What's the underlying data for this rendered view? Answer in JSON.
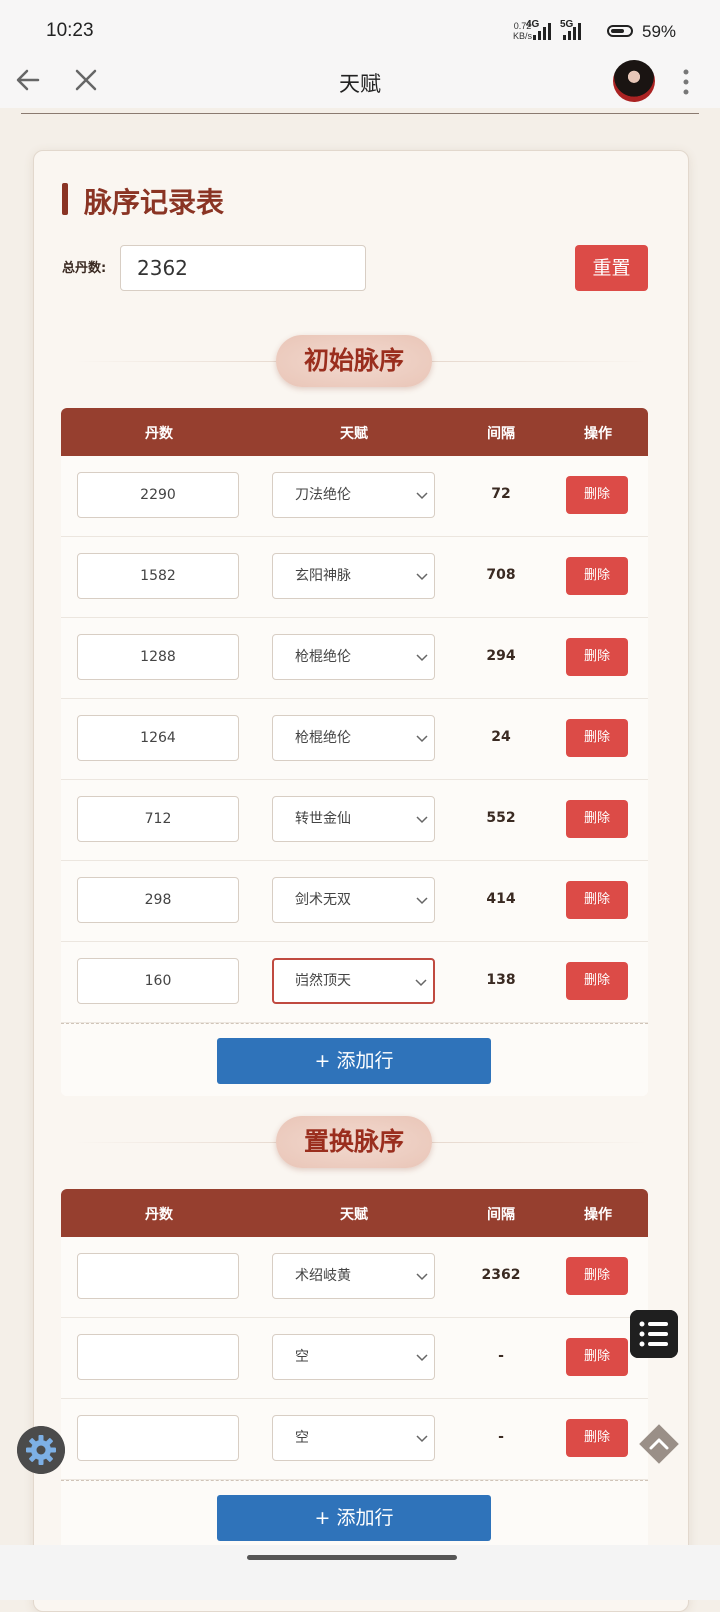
{
  "status_bar": {
    "time": "10:23",
    "net_speed_value": "0.72",
    "net_speed_unit": "KB/s",
    "signal1": "4G",
    "signal2": "5G",
    "battery": "59%"
  },
  "nav": {
    "title": "天赋"
  },
  "card": {
    "title": "脉序记录表",
    "total_label": "总丹数:",
    "total_value": "2362",
    "reset_label": "重置"
  },
  "section1": {
    "title": "初始脉序",
    "headers": [
      "丹数",
      "天赋",
      "间隔",
      "操作"
    ],
    "rows": [
      {
        "count": "2290",
        "talent": "刀法绝伦",
        "interval": "72",
        "action": "删除"
      },
      {
        "count": "1582",
        "talent": "玄阳神脉",
        "interval": "708",
        "action": "删除"
      },
      {
        "count": "1288",
        "talent": "枪棍绝伦",
        "interval": "294",
        "action": "删除"
      },
      {
        "count": "1264",
        "talent": "枪棍绝伦",
        "interval": "24",
        "action": "删除"
      },
      {
        "count": "712",
        "talent": "转世金仙",
        "interval": "552",
        "action": "删除"
      },
      {
        "count": "298",
        "talent": "剑术无双",
        "interval": "414",
        "action": "删除"
      },
      {
        "count": "160",
        "talent": "岿然顶天",
        "interval": "138",
        "action": "删除"
      }
    ],
    "add_label": "+ 添加行"
  },
  "section2": {
    "title": "置换脉序",
    "headers": [
      "丹数",
      "天赋",
      "间隔",
      "操作"
    ],
    "rows": [
      {
        "count": "",
        "talent": "术绍岐黄",
        "interval": "2362",
        "action": "删除"
      },
      {
        "count": "",
        "talent": "空",
        "interval": "-",
        "action": "删除"
      },
      {
        "count": "",
        "talent": "空",
        "interval": "-",
        "action": "删除"
      }
    ],
    "add_label": "+ 添加行"
  },
  "colors": {
    "accent": "#963f2f",
    "danger": "#dc4b47",
    "primary": "#2f73ba"
  },
  "icons": [
    "arrow-left-icon",
    "close-icon",
    "more-vert-icon",
    "list-icon",
    "gear-icon",
    "chevron-up-icon",
    "chevron-down-icon"
  ]
}
